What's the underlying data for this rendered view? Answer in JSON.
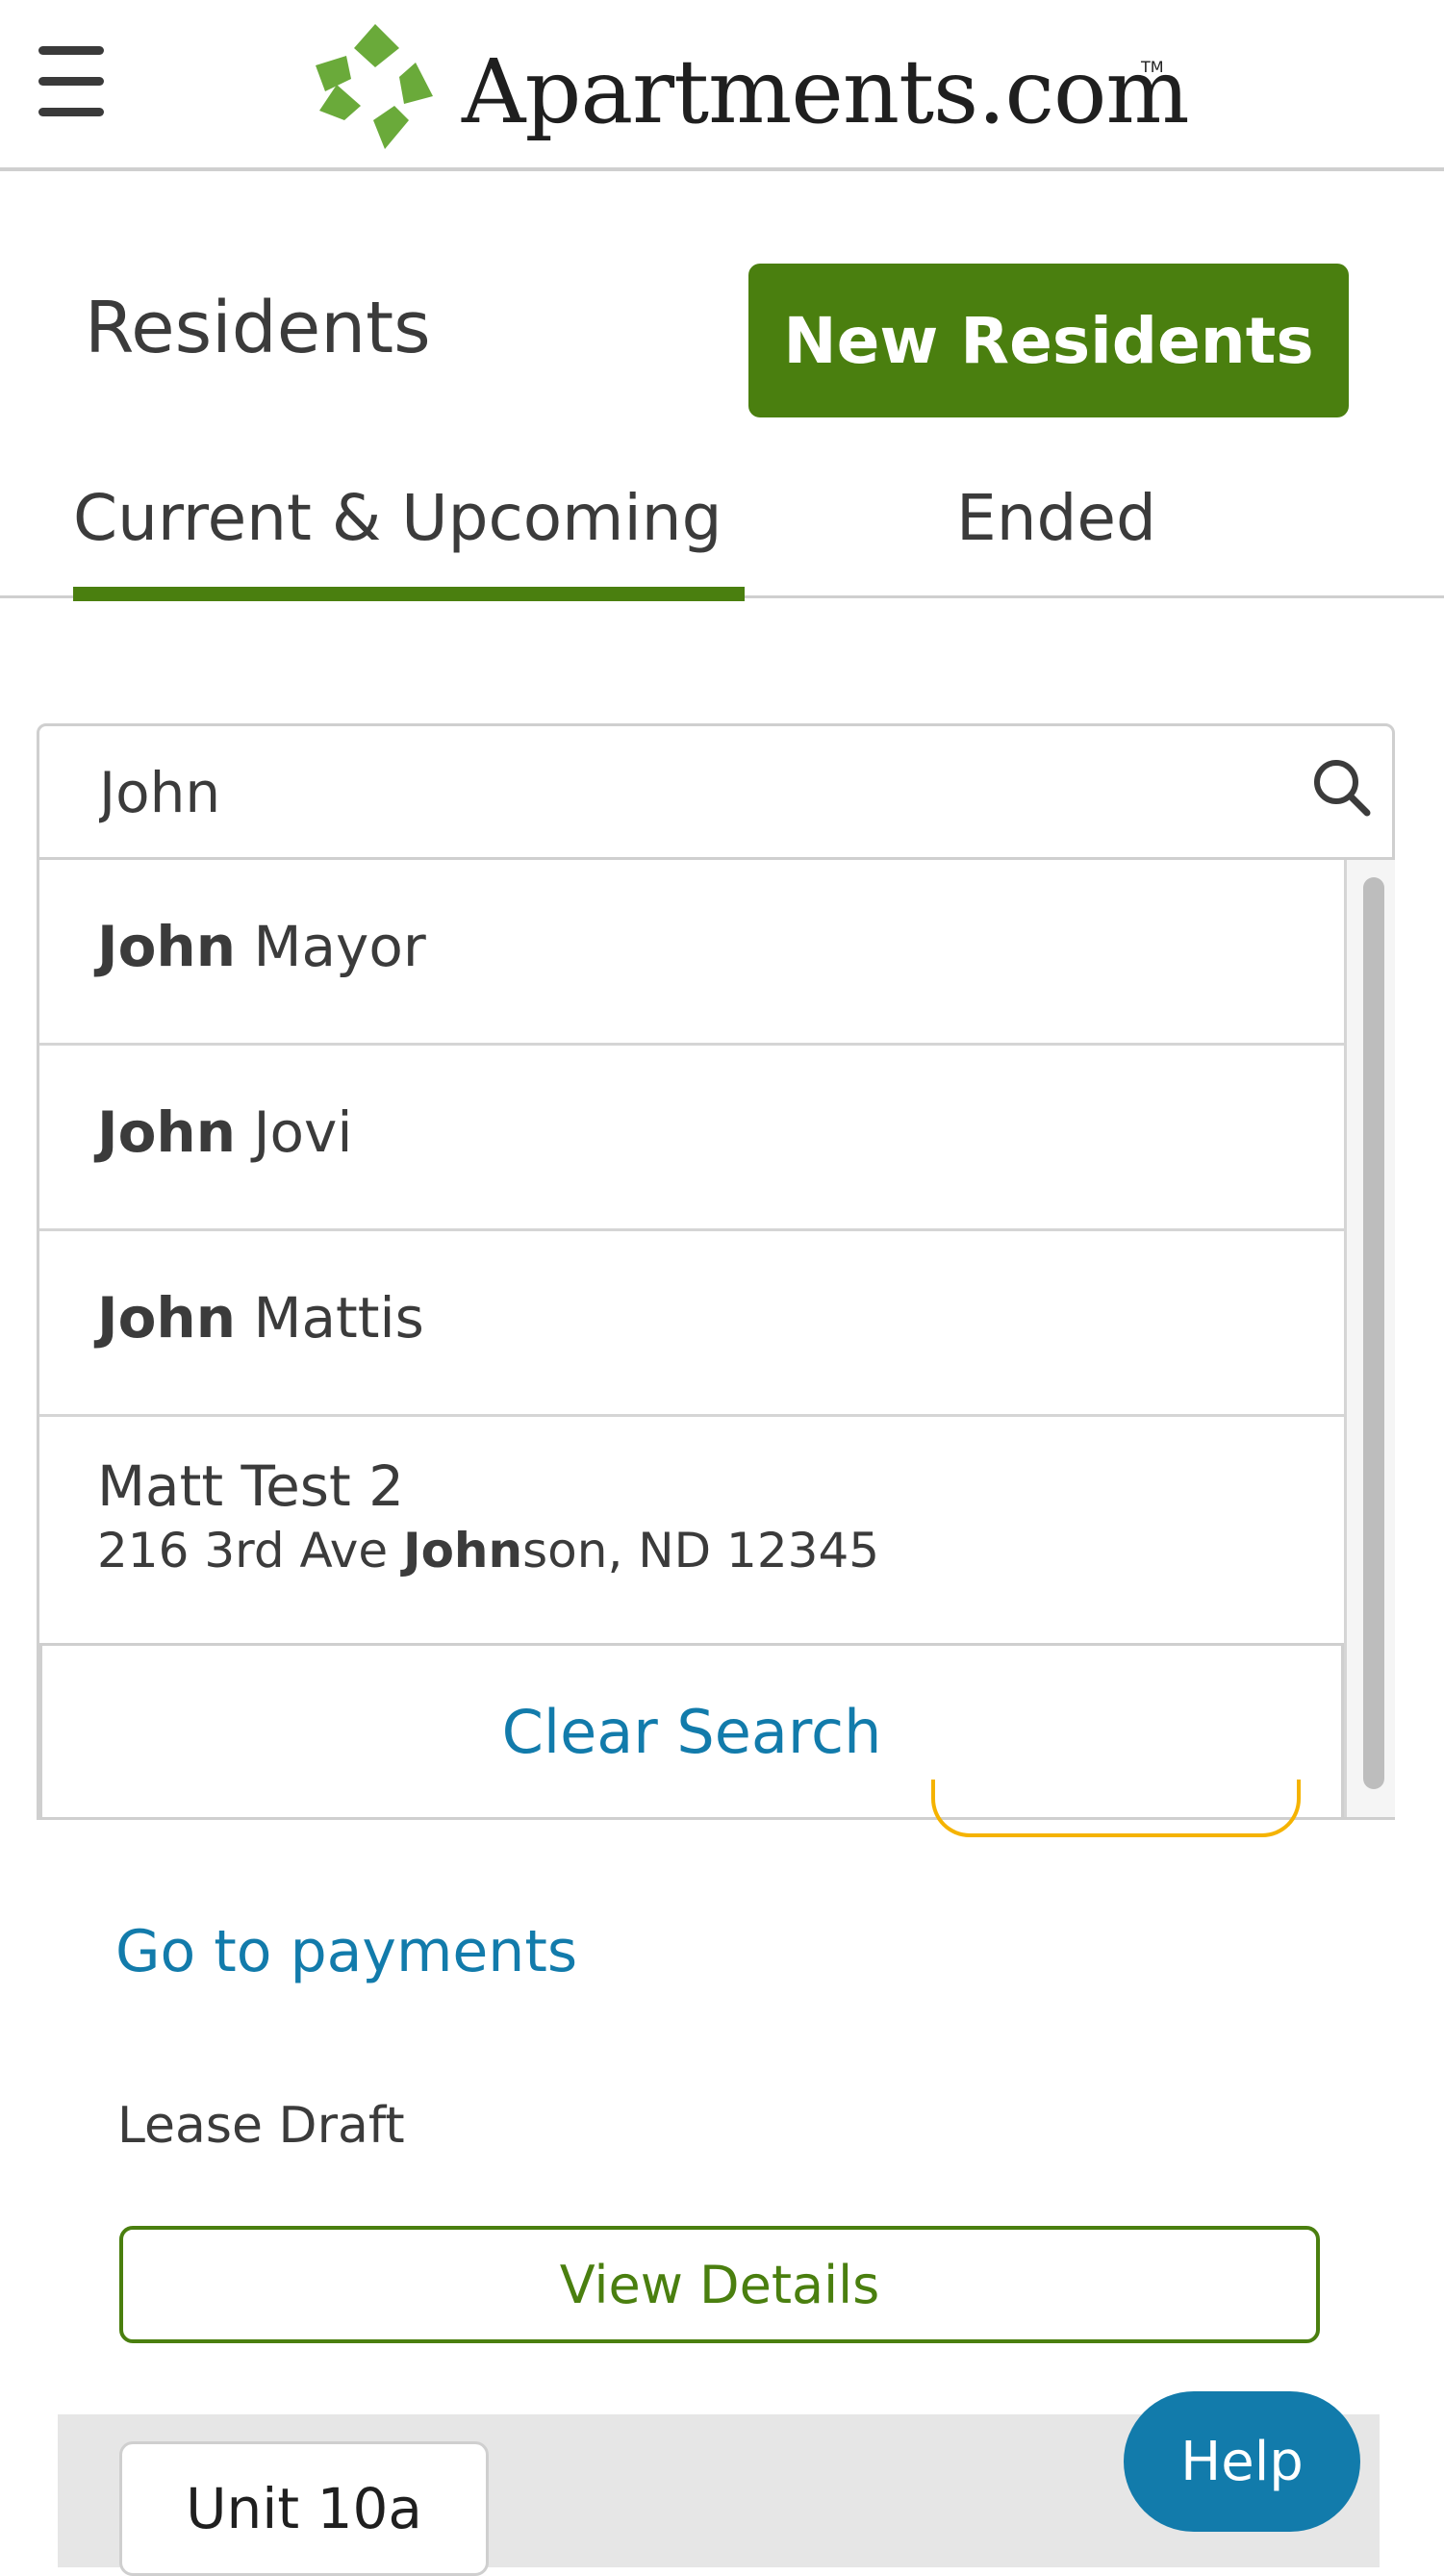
{
  "header": {
    "brand": "Apartments.com",
    "trademark": "TM",
    "brand_color": "#6aaa3a"
  },
  "page": {
    "title": "Residents",
    "new_button": "New Residents",
    "accent": "#4a7f0f"
  },
  "tabs": [
    {
      "label": "Current & Upcoming",
      "active": true
    },
    {
      "label": "Ended",
      "active": false
    }
  ],
  "search": {
    "value": "John",
    "results": [
      {
        "match": "John",
        "rest": " Mayor"
      },
      {
        "match": "John",
        "rest": " Jovi"
      },
      {
        "match": "John",
        "rest": " Mattis"
      },
      {
        "name": "Matt Test 2",
        "addr_pre": "216 3rd Ave ",
        "addr_match": "John",
        "addr_post": "son, ND 12345"
      }
    ],
    "clear_label": "Clear Search"
  },
  "card": {
    "payments_link": "Go to payments",
    "status_label": "Lease Draft",
    "view_details": "View Details",
    "unit": "Unit 10a"
  },
  "help": {
    "label": "Help",
    "color": "#127bab"
  }
}
